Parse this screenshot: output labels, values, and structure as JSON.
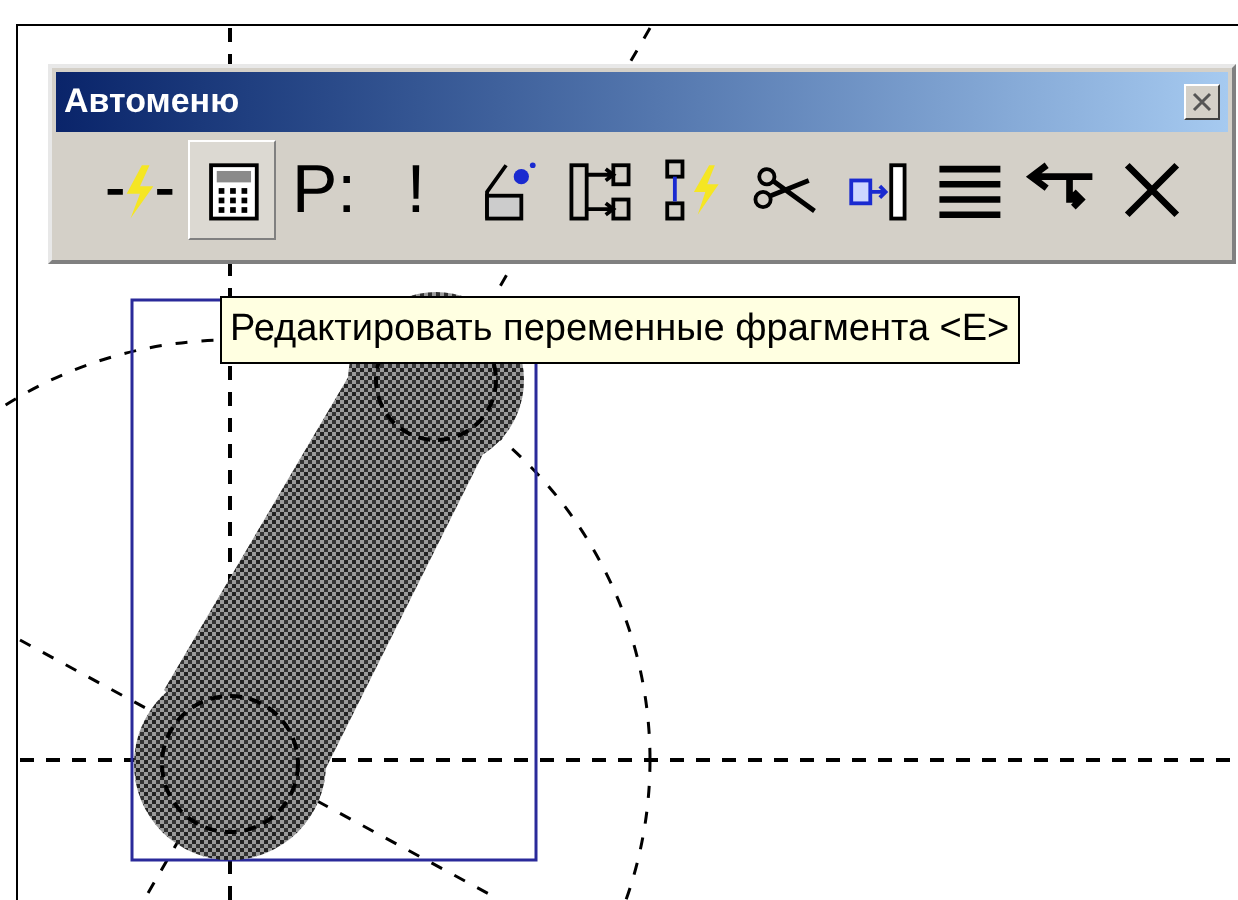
{
  "toolbar": {
    "title": "Автоменю",
    "buttons": [
      {
        "selected": false
      },
      {
        "selected": true
      },
      {
        "label": "P:",
        "selected": false
      },
      {
        "label": "!",
        "selected": false
      },
      {
        "selected": false
      },
      {
        "selected": false
      },
      {
        "selected": false
      },
      {
        "selected": false
      },
      {
        "selected": false
      },
      {
        "selected": false
      },
      {
        "selected": false
      },
      {
        "selected": false
      }
    ]
  },
  "tooltip": "Редактировать переменные фрагмента <E>"
}
